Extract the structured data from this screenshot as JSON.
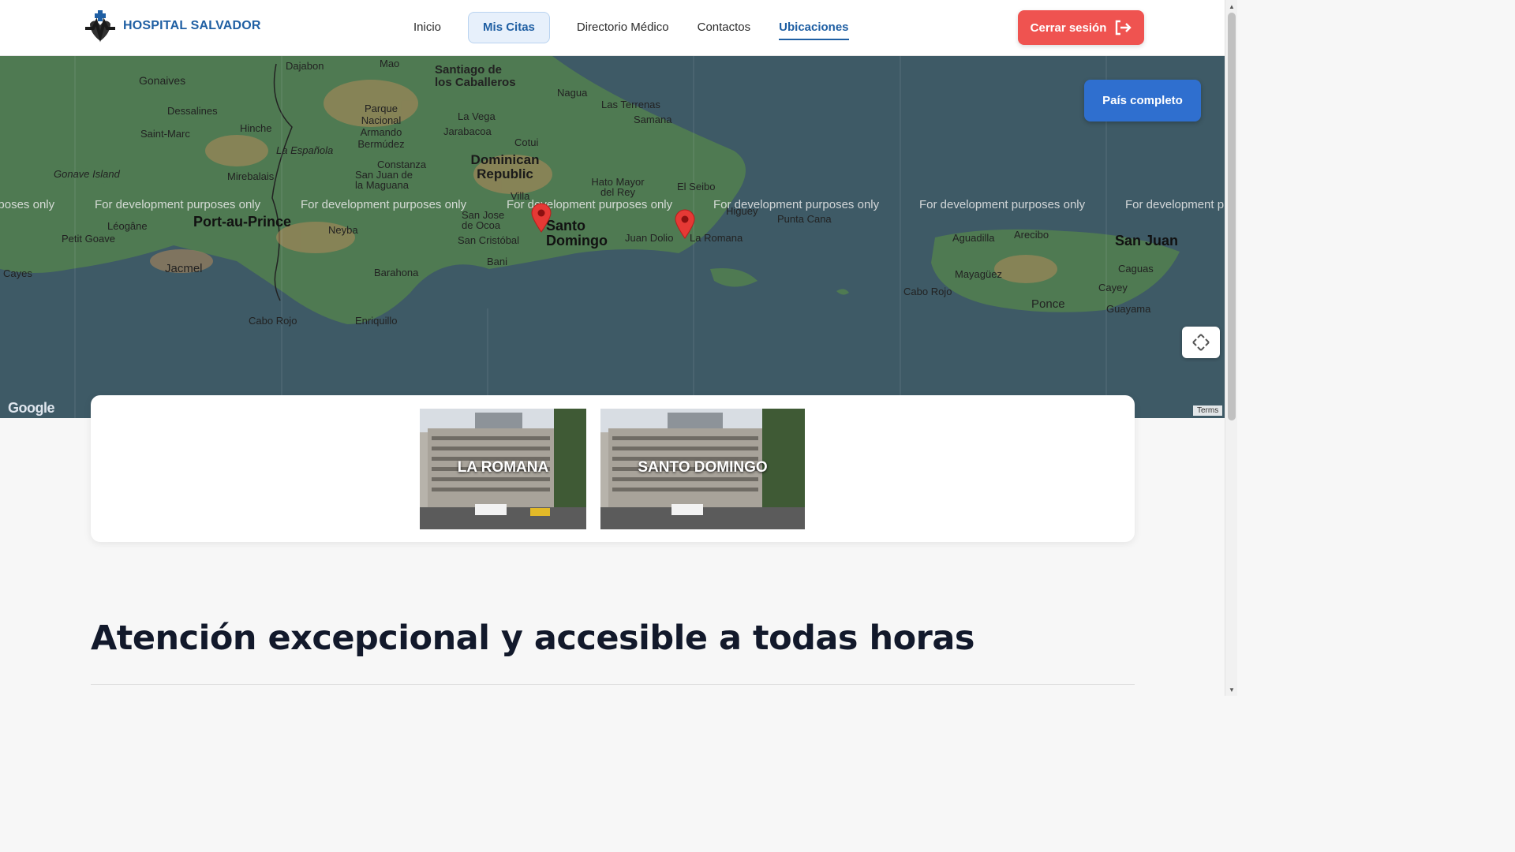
{
  "header": {
    "brand": "HOSPITAL SALVADOR",
    "nav": [
      {
        "label": "Inicio"
      },
      {
        "label": "Mis Citas"
      },
      {
        "label": "Directorio Médico"
      },
      {
        "label": "Contactos"
      },
      {
        "label": "Ubicaciones"
      }
    ],
    "logout_label": "Cerrar sesión"
  },
  "map": {
    "button_label": "País completo",
    "watermark": "For development purposes only",
    "attribution": "Google",
    "terms": "Terms",
    "labels": {
      "gonaives": "Gonaives",
      "dessalines": "Dessalines",
      "saint_marc": "Saint-Marc",
      "hinche": "Hinche",
      "la_espanola": "La Española",
      "mirebalais": "Mirebalais",
      "gonave": "Gonave Island",
      "port_au_prince": "Port-au-Prince",
      "leogane": "Léogâne",
      "petit_goave": "Petit Goave",
      "jacmel": "Jacmel",
      "cayes": "Cayes",
      "dajabon": "Dajabon",
      "mao": "Mao",
      "santiago": "Santiago de los Caballeros",
      "parque": "Parque Nacional Armando Bermúdez",
      "la_vega": "La Vega",
      "jarabacoa": "Jarabacoa",
      "cotui": "Cotui",
      "nagua": "Nagua",
      "las_terrenas": "Las Terrenas",
      "samana": "Samana",
      "dominican": "Dominican Republic",
      "constanza": "Constanza",
      "san_juan": "San Juan de la Maguana",
      "villa": "Villa",
      "hato_mayor": "Hato Mayor del Rey",
      "el_seibo": "El Seibo",
      "higuey": "Higuey",
      "punta_cana": "Punta Cana",
      "san_jose": "San Jose de Ocoa",
      "neyba": "Neyba",
      "san_cristobal": "San Cristóbal",
      "santo_domingo": "Santo Domingo",
      "juan_dolio": "Juan Dolio",
      "la_romana": "La Romana",
      "bani": "Bani",
      "barahona": "Barahona",
      "cabo_rojo_do": "Cabo Rojo",
      "enriquillo": "Enriquillo",
      "aguadilla": "Aguadilla",
      "arecibo": "Arecibo",
      "san_juan_pr": "San Juan",
      "mayaguez": "Mayagüez",
      "caguas": "Caguas",
      "cabo_rojo_pr": "Cabo Rojo",
      "ponce": "Ponce",
      "cayey": "Cayey",
      "guayama": "Guayama"
    },
    "markers": [
      "Santo Domingo",
      "La Romana"
    ]
  },
  "locations": [
    {
      "name": "LA ROMANA"
    },
    {
      "name": "SANTO DOMINGO"
    }
  ],
  "headline": "Atención excepcional y accesible a todas horas",
  "colors": {
    "brand": "#1f5fa3",
    "logout": "#ef5350",
    "map_button": "#2f6fcf",
    "marker": "#e53935"
  }
}
